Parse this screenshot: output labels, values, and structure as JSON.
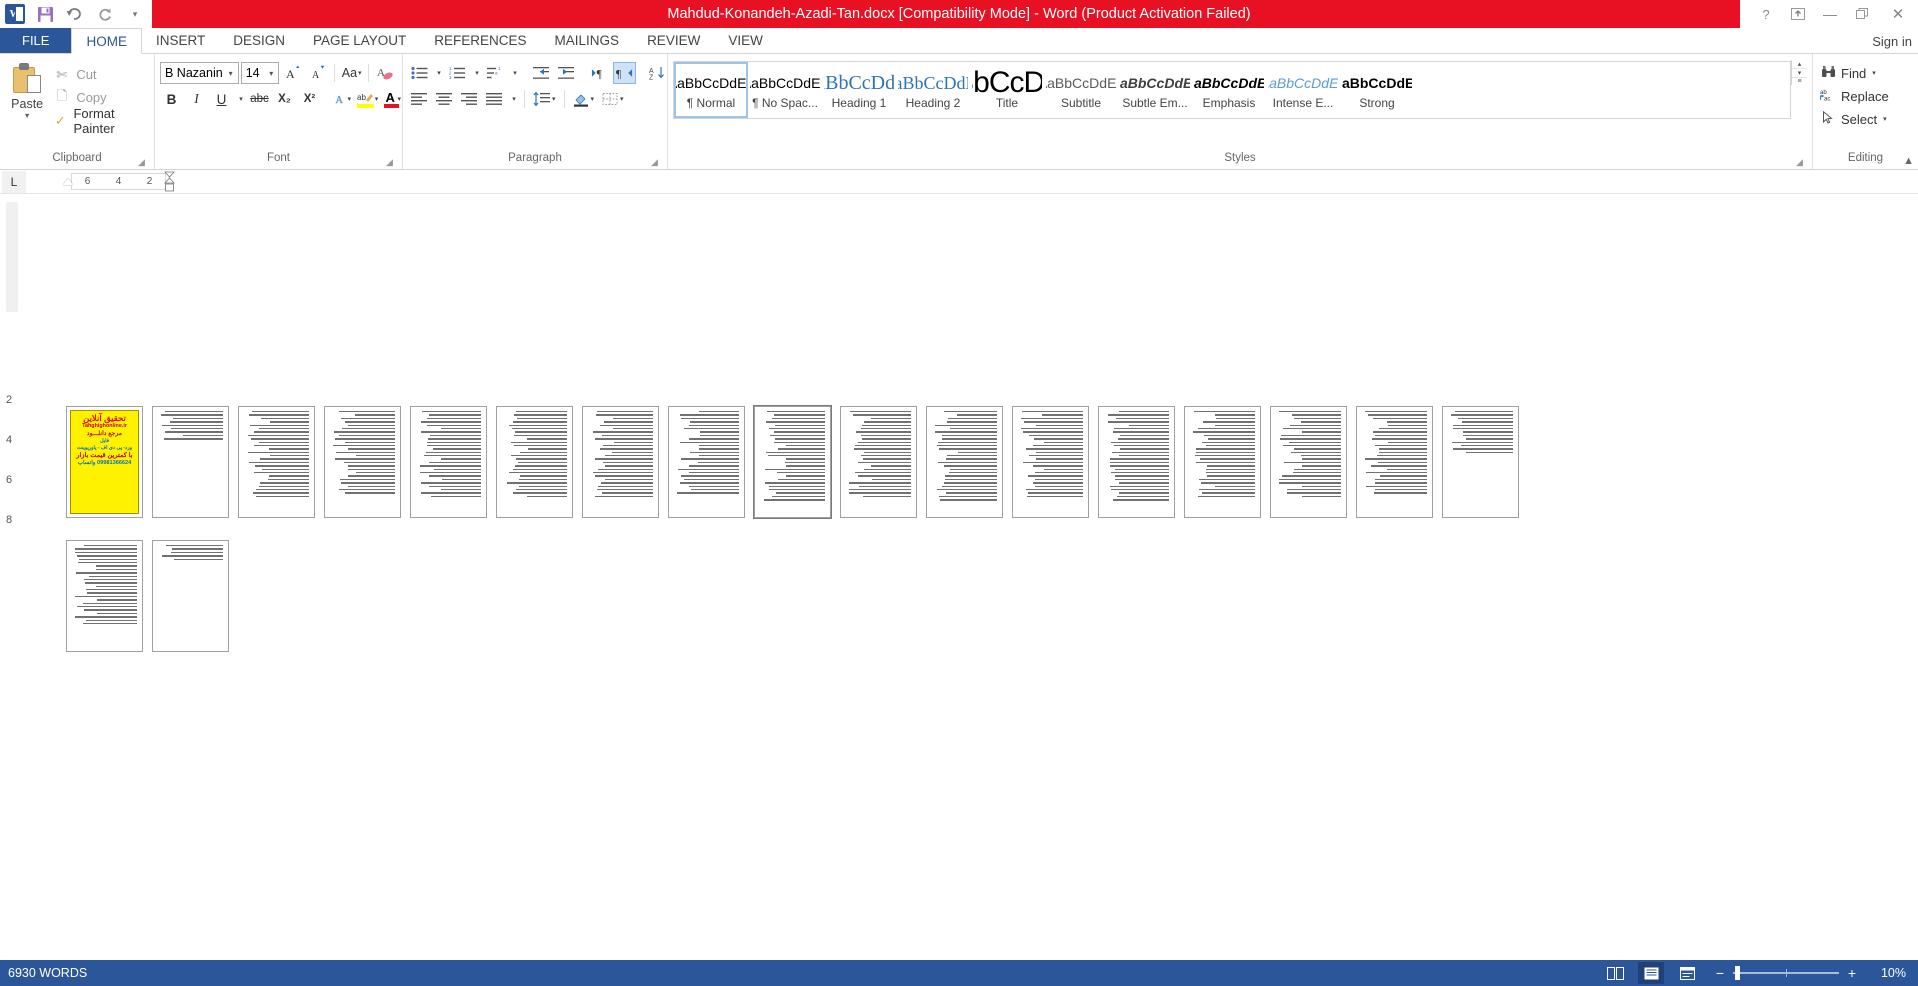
{
  "titlebar": {
    "document_title": "Mahdud-Konandeh-Azadi-Tan.docx [Compatibility Mode]  -  Word (Product Activation Failed)",
    "quick_access": [
      {
        "name": "word-logo",
        "label": "W"
      },
      {
        "name": "save-icon",
        "label": "💾"
      },
      {
        "name": "undo-icon",
        "label": "↶"
      },
      {
        "name": "redo-icon",
        "label": "↻"
      },
      {
        "name": "customize-qat-icon",
        "label": "▾"
      }
    ],
    "window_controls": [
      {
        "name": "help-button",
        "label": "?"
      },
      {
        "name": "ribbon-display-options-button",
        "label": "⬆"
      },
      {
        "name": "minimize-button",
        "label": "—"
      },
      {
        "name": "restore-button",
        "label": "❐"
      },
      {
        "name": "close-button",
        "label": "✕"
      }
    ],
    "sign_in": "Sign in"
  },
  "tabs": [
    {
      "name": "file",
      "label": "FILE"
    },
    {
      "name": "home",
      "label": "HOME"
    },
    {
      "name": "insert",
      "label": "INSERT"
    },
    {
      "name": "design",
      "label": "DESIGN"
    },
    {
      "name": "page-layout",
      "label": "PAGE LAYOUT"
    },
    {
      "name": "references",
      "label": "REFERENCES"
    },
    {
      "name": "mailings",
      "label": "MAILINGS"
    },
    {
      "name": "review",
      "label": "REVIEW"
    },
    {
      "name": "view",
      "label": "VIEW"
    }
  ],
  "active_tab": "HOME",
  "clipboard": {
    "group_label": "Clipboard",
    "paste_label": "Paste",
    "cut_label": "Cut",
    "copy_label": "Copy",
    "format_painter_label": "Format Painter"
  },
  "font": {
    "group_label": "Font",
    "font_name": "B Nazanin",
    "font_size": "14",
    "grow_font": "A˄",
    "shrink_font": "A˅",
    "change_case": "Aa",
    "clear_formatting": "A",
    "bold": "B",
    "italic": "I",
    "underline": "U",
    "strikethrough": "abc",
    "subscript": "X₂",
    "superscript": "X²",
    "text_effects": "A",
    "highlight": "ab",
    "font_color": "A"
  },
  "paragraph": {
    "group_label": "Paragraph",
    "bullets": "•≡",
    "numbering": "1≡",
    "multilevel": "a≡",
    "decrease_indent": "←≡",
    "increase_indent": "→≡",
    "ltr_text": "▸¶",
    "rtl_text": "¶◂",
    "sort": "A↓",
    "show_marks": "¶",
    "align_left": "≡",
    "align_center": "≡",
    "align_right": "≡",
    "justify": "≡",
    "line_spacing": "↕≡",
    "shading": "▤",
    "borders": "⊞",
    "rtl_active": true
  },
  "styles": {
    "group_label": "Styles",
    "items": [
      {
        "preview": "AaBbCcDdEe",
        "name": "¶ Normal",
        "cls": "sp-normal",
        "selected": true
      },
      {
        "preview": "AaBbCcDdEe",
        "name": "¶ No Spac...",
        "cls": "sp-nospace",
        "selected": false
      },
      {
        "preview": "AaBbCcDdEe",
        "name": "Heading 1",
        "cls": "sp-h1",
        "selected": false
      },
      {
        "preview": "AaBbCcDdEe",
        "name": "Heading 2",
        "cls": "sp-h2",
        "selected": false
      },
      {
        "preview": "AaBbCcDdEe",
        "name": "Title",
        "cls": "sp-title",
        "selected": false
      },
      {
        "preview": "AaBbCcDdEe",
        "name": "Subtitle",
        "cls": "sp-subtitle",
        "selected": false
      },
      {
        "preview": "AaBbCcDdEe",
        "name": "Subtle Em...",
        "cls": "sp-subem",
        "selected": false
      },
      {
        "preview": "AaBbCcDdEe",
        "name": "Emphasis",
        "cls": "sp-em",
        "selected": false
      },
      {
        "preview": "AaBbCcDdEe",
        "name": "Intense E...",
        "cls": "sp-intense",
        "selected": false
      },
      {
        "preview": "AaBbCcDdEe",
        "name": "Strong",
        "cls": "sp-strong",
        "selected": false
      }
    ],
    "scroll_up": "▴",
    "scroll_down": "▾",
    "more": "▾"
  },
  "editing": {
    "group_label": "Editing",
    "find_label": "Find",
    "replace_label": "Replace",
    "select_label": "Select"
  },
  "ruler": {
    "tab_selector": "L",
    "ticks": [
      "6",
      "4",
      "2"
    ]
  },
  "row_labels": [
    "2",
    "4",
    "6",
    "8"
  ],
  "document": {
    "pages": [
      {
        "index": 1,
        "type": "ad"
      },
      {
        "index": 2,
        "type": "text",
        "lines": 9,
        "density": "sparse"
      },
      {
        "index": 3,
        "type": "text",
        "lines": 26,
        "density": "dense"
      },
      {
        "index": 4,
        "type": "text",
        "lines": 25,
        "density": "dense"
      },
      {
        "index": 5,
        "type": "text",
        "lines": 26,
        "density": "dense"
      },
      {
        "index": 6,
        "type": "text",
        "lines": 26,
        "density": "dense"
      },
      {
        "index": 7,
        "type": "text",
        "lines": 26,
        "density": "dense"
      },
      {
        "index": 8,
        "type": "text",
        "lines": 25,
        "density": "dense"
      },
      {
        "index": 9,
        "type": "text",
        "lines": 27,
        "density": "dense",
        "selected": true
      },
      {
        "index": 10,
        "type": "text",
        "lines": 26,
        "density": "dense"
      },
      {
        "index": 11,
        "type": "text",
        "lines": 27,
        "density": "dense"
      },
      {
        "index": 12,
        "type": "text",
        "lines": 26,
        "density": "dense"
      },
      {
        "index": 13,
        "type": "text",
        "lines": 27,
        "density": "dense"
      },
      {
        "index": 14,
        "type": "text",
        "lines": 26,
        "density": "dense"
      },
      {
        "index": 15,
        "type": "text",
        "lines": 26,
        "density": "dense"
      },
      {
        "index": 16,
        "type": "text",
        "lines": 25,
        "density": "dense"
      },
      {
        "index": 17,
        "type": "text",
        "lines": 13,
        "density": "medium"
      },
      {
        "index": 18,
        "type": "text",
        "lines": 24,
        "density": "dense"
      },
      {
        "index": 19,
        "type": "text",
        "lines": 5,
        "density": "sparse"
      }
    ],
    "ad_page": {
      "line1": "تحقیق آنلاین",
      "line2": "Tahghighonline.ir",
      "line3": "مرجع دانلـــود",
      "line4": "فایل",
      "line5": "ورد- پی دی اف - پاورپوینت",
      "line6": "با کمترین قیمت بازار",
      "line7": "09981366624 واتساپ"
    }
  },
  "statusbar": {
    "word_count": "6930 WORDS",
    "views": [
      {
        "name": "read-mode",
        "label": "▤"
      },
      {
        "name": "print-layout",
        "label": "▦"
      },
      {
        "name": "web-layout",
        "label": "▧"
      }
    ],
    "zoom_out": "−",
    "zoom_in": "+",
    "zoom_level": "10%"
  }
}
